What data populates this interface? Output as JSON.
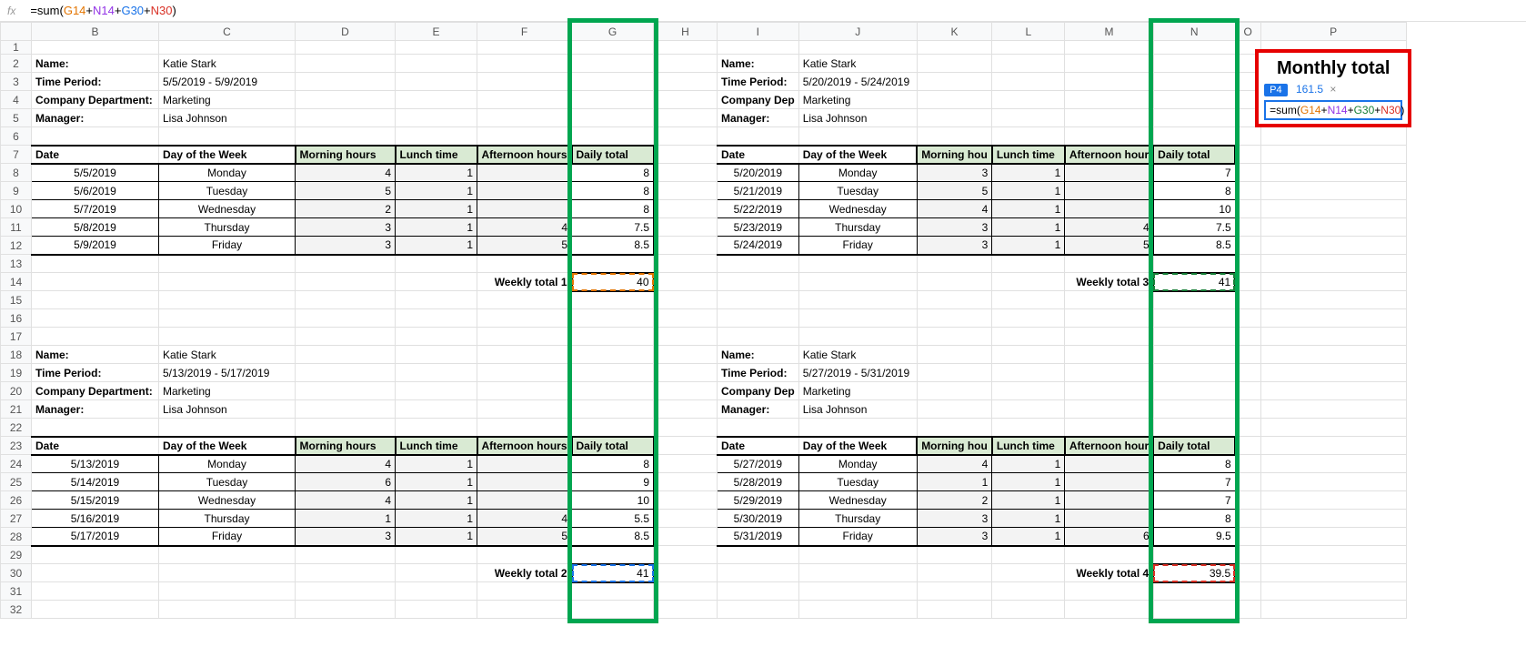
{
  "formula_bar": {
    "fx": "fx",
    "prefix": "=sum(",
    "r1": "G14",
    "plus": "+",
    "r2": "N14",
    "r3": "G30",
    "r4": "N30",
    "suffix": ")"
  },
  "columns": [
    "B",
    "C",
    "D",
    "E",
    "F",
    "G",
    "H",
    "I",
    "J",
    "K",
    "L",
    "M",
    "N",
    "O",
    "P"
  ],
  "col_widths": {
    "B": 140,
    "C": 150,
    "D": 110,
    "E": 90,
    "F": 100,
    "G": 90,
    "H": 70,
    "I": 80,
    "J": 130,
    "K": 80,
    "L": 80,
    "M": 90,
    "N": 90,
    "O": 28,
    "P": 160
  },
  "meta_labels": {
    "name": "Name:",
    "period": "Time Period:",
    "dept": "Company Department:",
    "dept_short": "Company Dep",
    "manager": "Manager:"
  },
  "headers": {
    "date": "Date",
    "dow": "Day of the Week",
    "morning": "Morning hours",
    "lunch": "Lunch time",
    "afternoon": "Afternoon hours",
    "afternoon_short": "Afternoon hour",
    "morning_short": "Morning hou",
    "daily": "Daily total"
  },
  "weekly_labels": {
    "w1": "Weekly total 1",
    "w2": "Weekly total 2",
    "w3": "Weekly total 3",
    "w4": "Weekly total 4"
  },
  "weekly_totals": {
    "w1": "40",
    "w2": "41",
    "w3": "41",
    "w4": "39.5"
  },
  "blocks": {
    "b1": {
      "name": "Katie Stark",
      "period": "5/5/2019 - 5/9/2019",
      "dept": "Marketing",
      "manager": "Lisa Johnson",
      "rows": [
        {
          "date": "5/5/2019",
          "dow": "Monday",
          "m": "4",
          "l": "1",
          "a": "",
          "t": "8"
        },
        {
          "date": "5/6/2019",
          "dow": "Tuesday",
          "m": "5",
          "l": "1",
          "a": "",
          "t": "8"
        },
        {
          "date": "5/7/2019",
          "dow": "Wednesday",
          "m": "2",
          "l": "1",
          "a": "",
          "t": "8"
        },
        {
          "date": "5/8/2019",
          "dow": "Thursday",
          "m": "3",
          "l": "1",
          "a": "4",
          "t": "7.5"
        },
        {
          "date": "5/9/2019",
          "dow": "Friday",
          "m": "3",
          "l": "1",
          "a": "5",
          "t": "8.5"
        }
      ]
    },
    "b2": {
      "name": "Katie Stark",
      "period": "5/13/2019 - 5/17/2019",
      "dept": "Marketing",
      "manager": "Lisa Johnson",
      "rows": [
        {
          "date": "5/13/2019",
          "dow": "Monday",
          "m": "4",
          "l": "1",
          "a": "",
          "t": "8"
        },
        {
          "date": "5/14/2019",
          "dow": "Tuesday",
          "m": "6",
          "l": "1",
          "a": "",
          "t": "9"
        },
        {
          "date": "5/15/2019",
          "dow": "Wednesday",
          "m": "4",
          "l": "1",
          "a": "",
          "t": "10"
        },
        {
          "date": "5/16/2019",
          "dow": "Thursday",
          "m": "1",
          "l": "1",
          "a": "4",
          "t": "5.5"
        },
        {
          "date": "5/17/2019",
          "dow": "Friday",
          "m": "3",
          "l": "1",
          "a": "5",
          "t": "8.5"
        }
      ]
    },
    "b3": {
      "name": "Katie Stark",
      "period": "5/20/2019 - 5/24/2019",
      "dept": "Marketing",
      "manager": "Lisa Johnson",
      "rows": [
        {
          "date": "5/20/2019",
          "dow": "Monday",
          "m": "3",
          "l": "1",
          "a": "",
          "t": "7"
        },
        {
          "date": "5/21/2019",
          "dow": "Tuesday",
          "m": "5",
          "l": "1",
          "a": "",
          "t": "8"
        },
        {
          "date": "5/22/2019",
          "dow": "Wednesday",
          "m": "4",
          "l": "1",
          "a": "",
          "t": "10"
        },
        {
          "date": "5/23/2019",
          "dow": "Thursday",
          "m": "3",
          "l": "1",
          "a": "4",
          "t": "7.5"
        },
        {
          "date": "5/24/2019",
          "dow": "Friday",
          "m": "3",
          "l": "1",
          "a": "5",
          "t": "8.5"
        }
      ]
    },
    "b4": {
      "name": "Katie Stark",
      "period": "5/27/2019 - 5/31/2019",
      "dept": "Marketing",
      "manager": "Lisa Johnson",
      "rows": [
        {
          "date": "5/27/2019",
          "dow": "Monday",
          "m": "4",
          "l": "1",
          "a": "",
          "t": "8"
        },
        {
          "date": "5/28/2019",
          "dow": "Tuesday",
          "m": "1",
          "l": "1",
          "a": "",
          "t": "7"
        },
        {
          "date": "5/29/2019",
          "dow": "Wednesday",
          "m": "2",
          "l": "1",
          "a": "",
          "t": "7"
        },
        {
          "date": "5/30/2019",
          "dow": "Thursday",
          "m": "3",
          "l": "1",
          "a": "",
          "t": "8"
        },
        {
          "date": "5/31/2019",
          "dow": "Friday",
          "m": "3",
          "l": "1",
          "a": "6",
          "t": "9.5"
        }
      ]
    }
  },
  "monthly": {
    "title": "Monthly total",
    "cellref": "P4",
    "preview": "161.5",
    "x": "×",
    "prefix": "=sum(",
    "r1": "G14",
    "r2": "N14",
    "r3": "G30",
    "r4": "N30",
    "plus": "+",
    "suffix": ")"
  },
  "rowcount": 32
}
